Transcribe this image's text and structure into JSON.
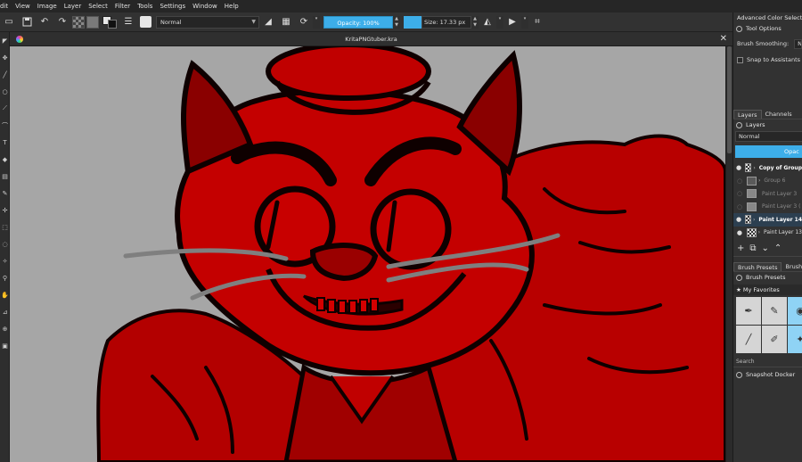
{
  "menubar": {
    "items": [
      {
        "name": "menu-edit",
        "label": "dit"
      },
      {
        "name": "menu-view",
        "label": "View"
      },
      {
        "name": "menu-image",
        "label": "Image"
      },
      {
        "name": "menu-layer",
        "label": "Layer"
      },
      {
        "name": "menu-select",
        "label": "Select"
      },
      {
        "name": "menu-filter",
        "label": "Filter"
      },
      {
        "name": "menu-tools",
        "label": "Tools"
      },
      {
        "name": "menu-settings",
        "label": "Settings"
      },
      {
        "name": "menu-window",
        "label": "Window"
      },
      {
        "name": "menu-help",
        "label": "Help"
      }
    ]
  },
  "toolbar": {
    "blend_mode": "Normal",
    "opacity_label": "Opacity: 100%",
    "size_label": "Size: 17.33 px"
  },
  "document": {
    "title": "KritaPNGtuber.kra",
    "close_glyph": "✕"
  },
  "docker": {
    "advanced_color_selector": "Advanced Color Selector",
    "tool_options_title": "Tool Options",
    "brush_smoothing_label": "Brush Smoothing:",
    "brush_smoothing_value": "N",
    "snap_to_assistants": "Snap to Assistants",
    "tabs": [
      "Layers",
      "Channels"
    ],
    "layers_title": "Layers",
    "layer_blend": "Normal",
    "layer_opacity_label": "Opac",
    "layers": [
      {
        "name": "Copy of Group",
        "visible": true,
        "dim": false,
        "bold": true,
        "kind": "art"
      },
      {
        "name": "Group 6",
        "visible": false,
        "dim": true,
        "bold": false,
        "kind": "grp"
      },
      {
        "name": "Paint Layer 3",
        "visible": false,
        "dim": true,
        "bold": false,
        "kind": "plain"
      },
      {
        "name": "Paint Layer 3 (",
        "visible": false,
        "dim": true,
        "bold": false,
        "kind": "plain"
      },
      {
        "name": "Paint Layer 14",
        "visible": true,
        "dim": false,
        "bold": true,
        "kind": "art",
        "selected": true
      },
      {
        "name": "Paint Layer 13",
        "visible": true,
        "dim": false,
        "bold": false,
        "kind": "art"
      }
    ],
    "preset_tabs": [
      "Brush Presets",
      "Brush E"
    ],
    "brush_presets_title": "Brush Presets",
    "favorites_label": "My Favorites",
    "search_label": "Search",
    "snapshot_docker": "Snapshot Docker"
  },
  "colors": {
    "accent": "#3daee9",
    "canvas_bg": "#a6a6a6",
    "art_red": "#c00000",
    "art_dark_red": "#7a0000",
    "ink": "#0d0000",
    "whisker": "#7f7f7f"
  },
  "icons": {
    "toolbar": [
      "new-file-icon",
      "save-icon",
      "undo-icon",
      "redo-icon",
      "eraser-icon",
      "alpha-lock-icon",
      "reload-icon",
      "mirror-horizontal-icon",
      "mirror-vertical-icon",
      "crop-icon"
    ],
    "toolbox": [
      "cursor-icon",
      "transform-icon",
      "brush-icon",
      "ellipse-icon",
      "line-icon",
      "path-icon",
      "text-icon",
      "fill-icon",
      "gradient-icon",
      "picker-icon",
      "move-icon",
      "select-rect-icon",
      "select-ellipse-icon",
      "lasso-icon",
      "zoom-icon",
      "pan-icon",
      "measure-icon",
      "assistant-icon",
      "reference-icon"
    ]
  }
}
